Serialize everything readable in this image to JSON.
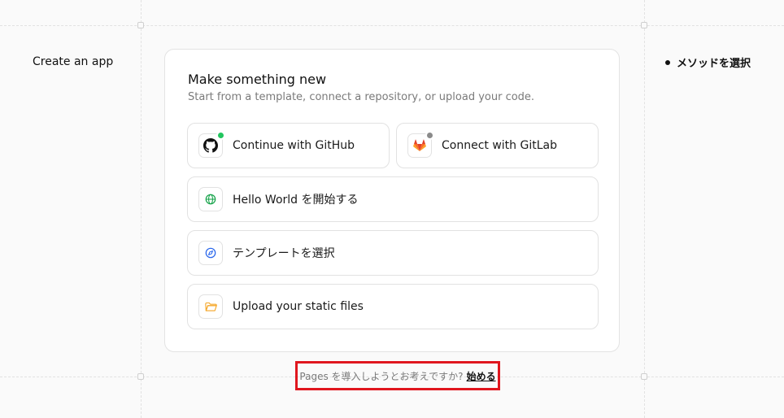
{
  "left_panel": {
    "title": "Create an app"
  },
  "right_panel": {
    "step_label": "メソッドを選択"
  },
  "card": {
    "title": "Make something new",
    "subtitle": "Start from a template, connect a repository, or upload your code.",
    "options": {
      "github": {
        "label": "Continue with GitHub",
        "icon": "github-icon",
        "status_color": "#22c55e"
      },
      "gitlab": {
        "label": "Connect with GitLab",
        "icon": "gitlab-icon",
        "status_color": "#8a8a8a"
      },
      "hello_world": {
        "label": "Hello World を開始する",
        "icon": "globe-icon"
      },
      "template": {
        "label": "テンプレートを選択",
        "icon": "compass-icon"
      },
      "upload": {
        "label": "Upload your static files",
        "icon": "folder-icon"
      }
    }
  },
  "footer": {
    "question": "Pages を導入しようとお考えですか?",
    "link_label": "始める"
  },
  "colors": {
    "highlight_border": "#e0161e",
    "gitlab_orange": "#e24329",
    "globe_green": "#16a34a",
    "compass_blue": "#2563eb",
    "folder_amber": "#f5a524"
  }
}
